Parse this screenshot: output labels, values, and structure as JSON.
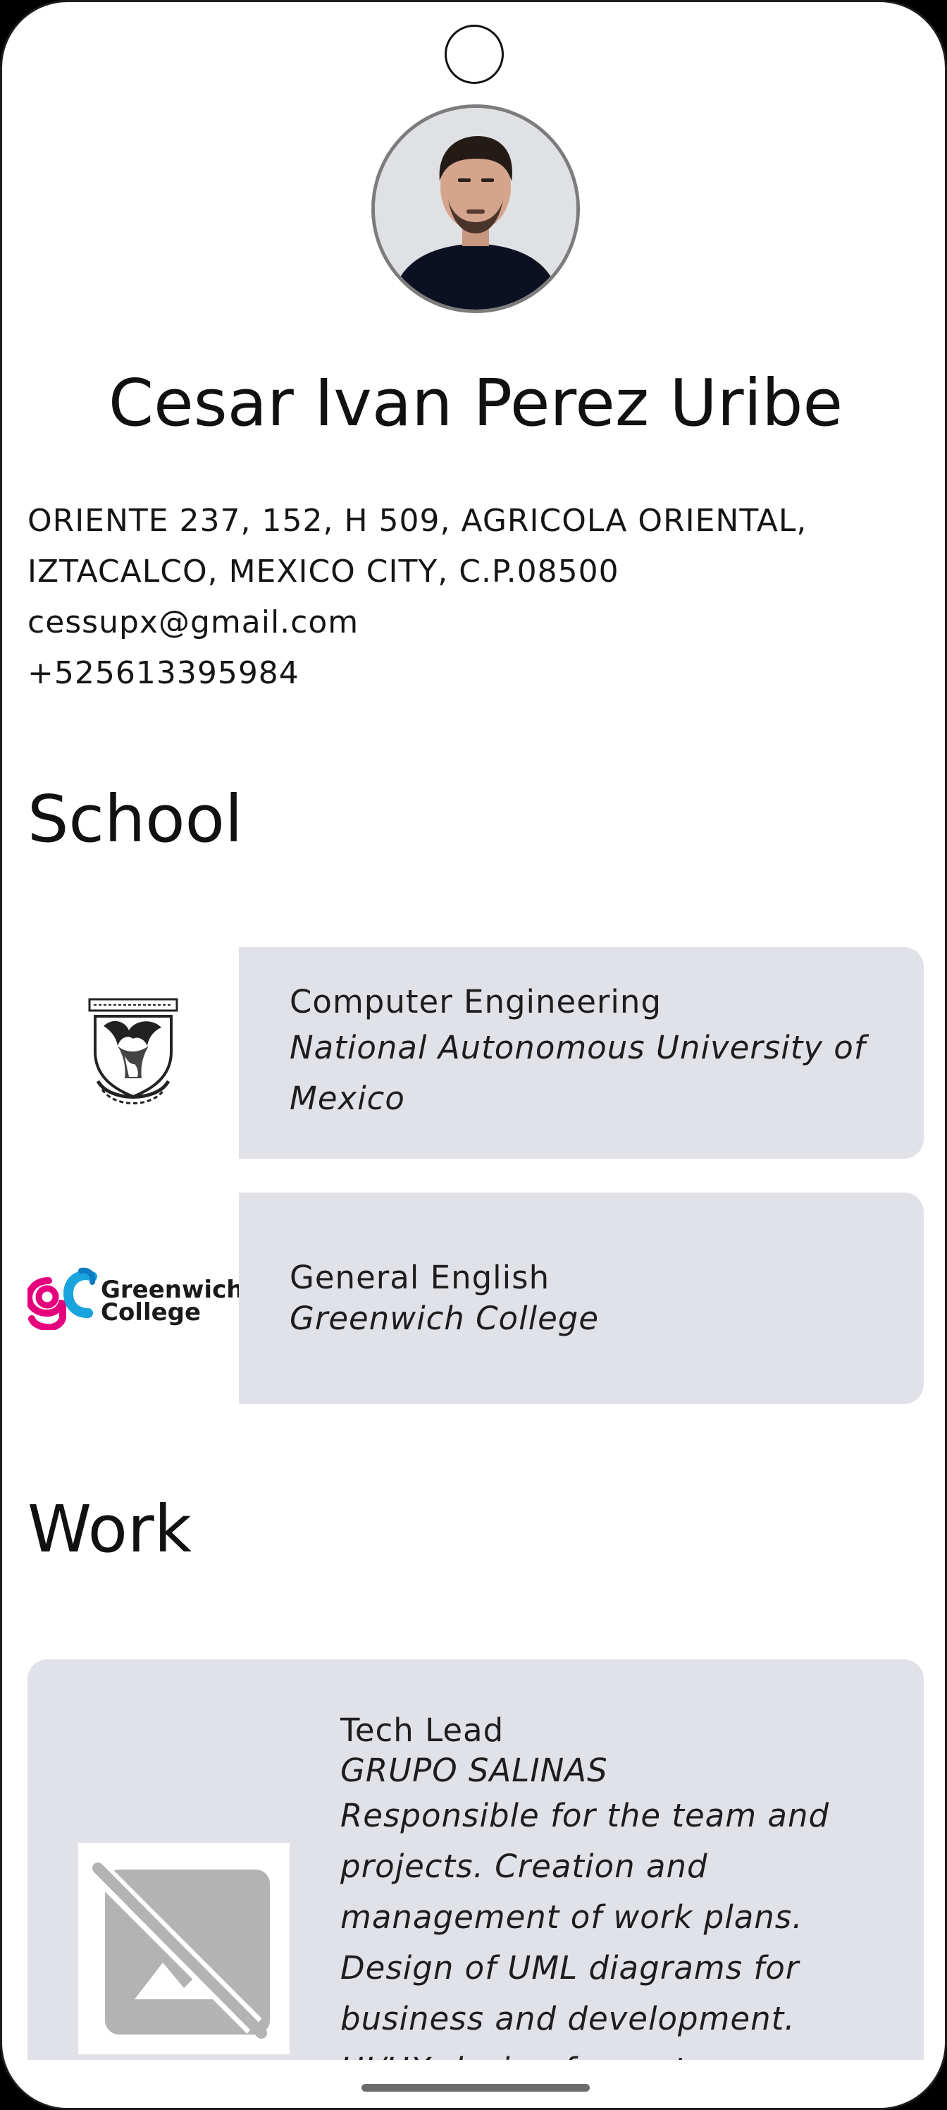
{
  "profile": {
    "name": "Cesar Ivan Perez Uribe",
    "address_line1": "ORIENTE 237, 152, H 509, AGRICOLA ORIENTAL,",
    "address_line2": "IZTACALCO, MEXICO CITY, C.P.08500",
    "email": "cessupx@gmail.com",
    "phone": "+525613395984"
  },
  "school": {
    "title": "School",
    "items": [
      {
        "degree": "Computer Engineering",
        "institution": "National Autonomous University of Mexico",
        "logo": "unam-crest-logo"
      },
      {
        "degree": "General English",
        "institution": "Greenwich College",
        "logo": "greenwich-college-logo",
        "logo_text_line1": "Greenwich",
        "logo_text_line2": "College"
      }
    ]
  },
  "work": {
    "title": "Work",
    "items": [
      {
        "role": "Tech Lead",
        "company": "GRUPO SALINAS",
        "description": "Responsible for the team and projects. Creation and management of work plans. Design of UML diagrams for business and development. UI/UX design for systems. Development",
        "image": "broken-image-icon"
      }
    ]
  },
  "colors": {
    "card_background": "#e1e2e7",
    "text": "#1d1d1d",
    "greenwich_pink": "#e5007e",
    "greenwich_blue": "#1aa4dd"
  }
}
